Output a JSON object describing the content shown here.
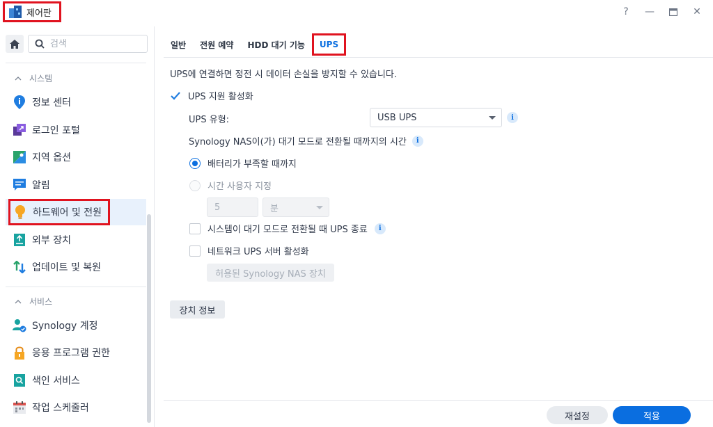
{
  "window": {
    "title": "제어판",
    "controls": {
      "help": "?",
      "minimize": "—",
      "maximize": "▭",
      "close": "✕"
    }
  },
  "sidebar": {
    "search_placeholder": "검색",
    "sections": [
      {
        "label": "시스템",
        "items": [
          "정보 센터",
          "로그인 포털",
          "지역 옵션",
          "알림",
          "하드웨어 및 전원",
          "외부 장치",
          "업데이트 및 복원"
        ]
      },
      {
        "label": "서비스",
        "items": [
          "Synology 계정",
          "응용 프로그램 권한",
          "색인 서비스",
          "작업 스케줄러"
        ]
      }
    ],
    "active_item": "하드웨어 및 전원"
  },
  "tabs": [
    "일반",
    "전원 예약",
    "HDD 대기 기능",
    "UPS"
  ],
  "active_tab": "UPS",
  "ups": {
    "description": "UPS에 연결하면 정전 시 데이터 손실을 방지할 수 있습니다.",
    "enable_label": "UPS 지원 활성화",
    "type_label": "UPS 유형:",
    "type_value": "USB UPS",
    "standby_label": "Synology NAS이(가) 대기 모드로 전환될 때까지의 시간",
    "radio_battery": "배터리가 부족할 때까지",
    "radio_custom": "시간 사용자 지정",
    "custom_value": "5",
    "custom_unit": "분",
    "shutdown_label": "시스템이 대기 모드로 전환될 때 UPS 종료",
    "network_label": "네트워크 UPS 서버 활성화",
    "allowed_button": "허용된 Synology NAS 장치",
    "device_info_button": "장치 정보"
  },
  "footer": {
    "reset": "재설정",
    "apply": "적용"
  }
}
